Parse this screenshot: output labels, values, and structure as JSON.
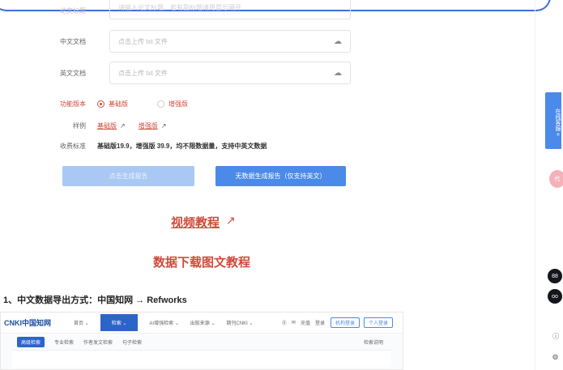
{
  "top_field": {
    "label": "论文标题",
    "placeholder": "请输入论文标题，若有副标题请用冒号隔开"
  },
  "upload_cn": {
    "label": "中文文档",
    "placeholder": "点击上传 txt 文件",
    "icon": "cloud-upload-icon"
  },
  "upload_en": {
    "label": "英文文档",
    "placeholder": "点击上传 txt 文件",
    "icon": "cloud-upload-icon"
  },
  "version": {
    "label": "功能版本",
    "options": [
      {
        "label": "基础版",
        "checked": true
      },
      {
        "label": "增强版",
        "checked": false
      }
    ]
  },
  "examples": {
    "label": "样例",
    "links": [
      {
        "label": "基础版"
      },
      {
        "label": "增强版"
      }
    ],
    "arrow": "↗"
  },
  "fee": {
    "label": "收费标准",
    "text": "基础版19.9，增强版 39.9，均不限数据量，支持中英文数据"
  },
  "buttons": {
    "generate": "点击生成报告",
    "no_data": "无数据生成报告（仅支持英文）"
  },
  "video_link": "视频教程",
  "video_arrow": "↗",
  "data_title": "数据下载图文教程",
  "section_heading": "1、中文数据导出方式：中国知网 → Refworks",
  "cnki": {
    "logo": "CNKI中国知网",
    "menu": [
      "首页 ⌄",
      "检索 ⌄",
      "AI增强检索 ⌄",
      "出版来源 ⌄",
      "期刊CNKI ⌄"
    ],
    "right": [
      "⓪",
      "✉",
      "充值",
      "登录"
    ],
    "right_buttons": [
      "机构登录",
      "个人登录"
    ],
    "tabs": [
      "高级检索",
      "专业检索",
      "作者发文检索",
      "句子检索"
    ],
    "tab_right": "检索说明"
  },
  "side": {
    "service": "在线客服 «",
    "pink": "代",
    "dark1": "88",
    "dark2": "oo",
    "mini1": "ⓘ",
    "mini2": "◍"
  },
  "colors": {
    "accent_red": "#d04a3a",
    "primary_blue": "#4b8ae8",
    "light_blue": "#a9c8f3"
  }
}
